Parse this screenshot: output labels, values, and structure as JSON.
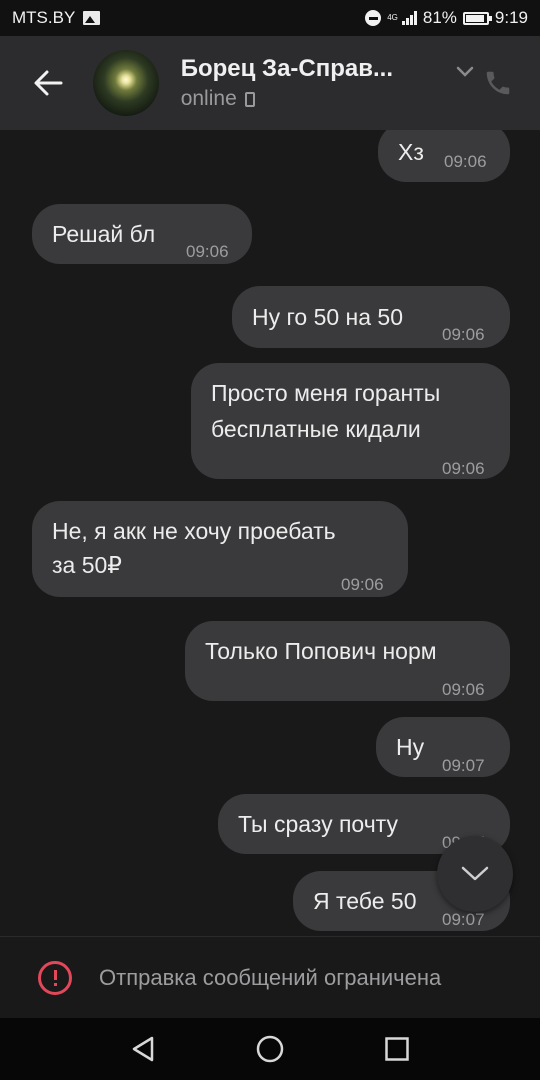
{
  "status_bar": {
    "carrier": "MTS.BY",
    "network": "4G",
    "battery": "81%",
    "time": "9:19",
    "icons": [
      "image-icon",
      "do-not-disturb-icon",
      "signal-icon",
      "battery-icon"
    ]
  },
  "header": {
    "contact_name": "Борец За-Справ...",
    "status": "online",
    "icons": [
      "back-arrow-icon",
      "avatar",
      "chevron-down-icon",
      "phone-icon",
      "mobile-device-icon"
    ]
  },
  "messages": [
    {
      "direction": "out",
      "text": "Хз",
      "time": "09:06"
    },
    {
      "direction": "in",
      "text": "Решай бл",
      "time": "09:06"
    },
    {
      "direction": "out",
      "text": "Ну го 50 на 50",
      "time": "09:06"
    },
    {
      "direction": "out",
      "lines": [
        "Просто меня горанты",
        "бесплатные кидали"
      ],
      "time": "09:06"
    },
    {
      "direction": "in",
      "lines": [
        "Не, я акк не хочу проебать",
        "за 50₽"
      ],
      "time": "09:06"
    },
    {
      "direction": "out",
      "text": "Только Попович норм",
      "time": "09:06"
    },
    {
      "direction": "out",
      "text": "Ну",
      "time": "09:07"
    },
    {
      "direction": "out",
      "text": "Ты сразу почту",
      "time": "09:07"
    },
    {
      "direction": "out",
      "text": "Я тебе 50",
      "time": "09:07"
    }
  ],
  "restriction": {
    "text": "Отправка сообщений ограничена",
    "icon": "warning-icon",
    "accent_color": "#e2475a"
  },
  "colors": {
    "background": "#19191a",
    "header": "#2c2c2e",
    "bubble": "#3a3a3c",
    "timestamp": "#9d9d9f"
  },
  "nav_bar": {
    "icons": [
      "back-triangle-icon",
      "home-circle-icon",
      "recents-square-icon"
    ]
  }
}
